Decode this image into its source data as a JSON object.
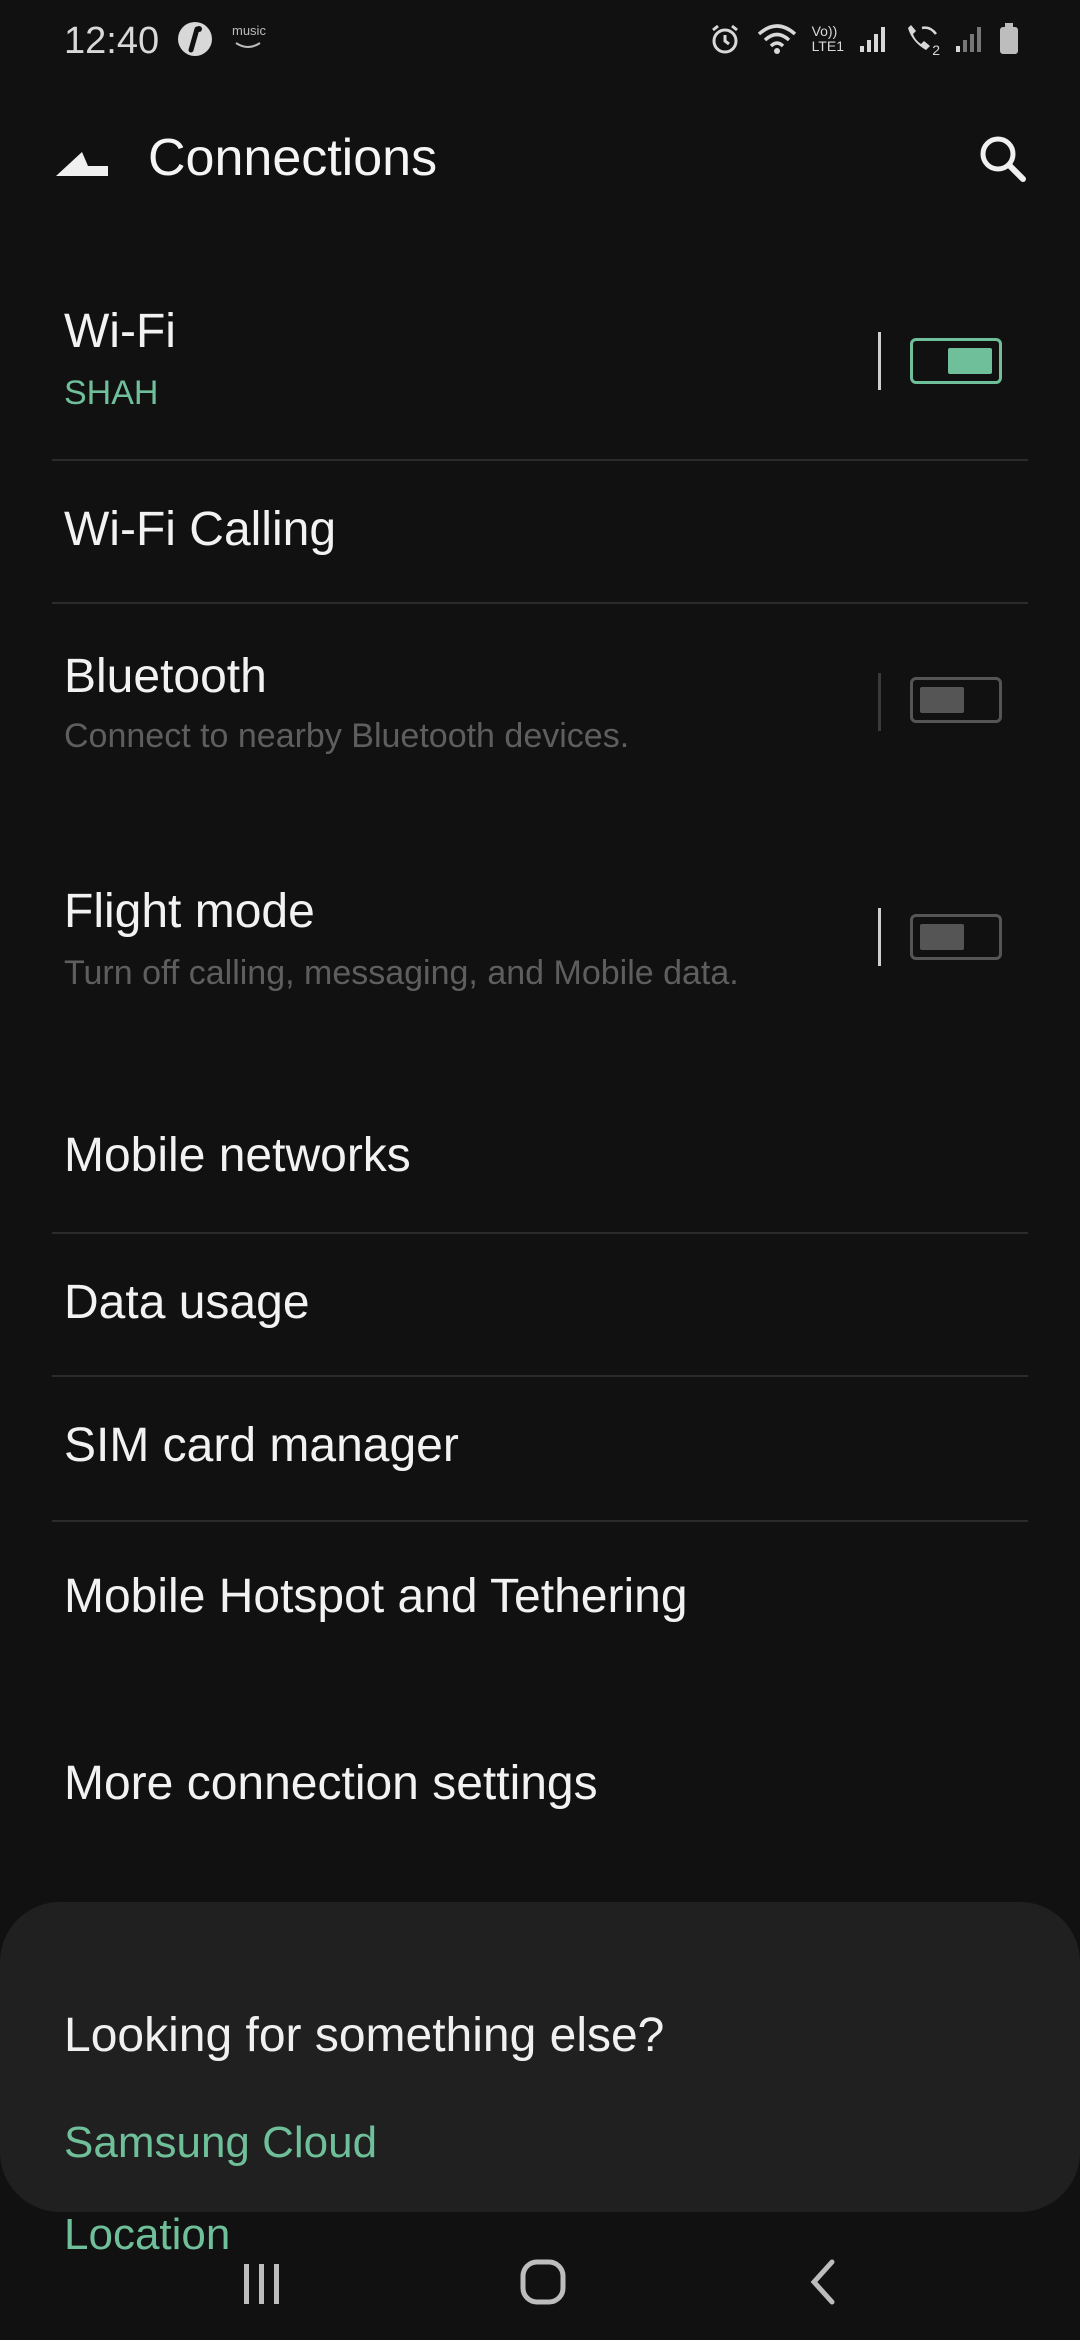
{
  "status_bar": {
    "time": "12:40",
    "icons_left": [
      "mobile-app-icon",
      "amazon-music-icon"
    ],
    "music_label": "music",
    "icons_right": [
      "alarm-icon",
      "wifi-icon",
      "volte-icon",
      "signal-icon",
      "wifi-calling-icon",
      "signal-icon-2",
      "battery-icon"
    ],
    "volte_label": "Vo))",
    "lte_label": "LTE1",
    "sim2_label": "2"
  },
  "header": {
    "title": "Connections"
  },
  "settings": [
    {
      "id": "wifi",
      "title": "Wi-Fi",
      "subtitle": "SHAH",
      "toggle": true,
      "state": "on"
    },
    {
      "id": "wifi-calling",
      "title": "Wi-Fi Calling"
    },
    {
      "id": "bluetooth",
      "title": "Bluetooth",
      "subtitle": "Connect to nearby Bluetooth devices.",
      "toggle": true,
      "state": "off"
    },
    {
      "id": "flight-mode",
      "title": "Flight mode",
      "subtitle": "Turn off calling, messaging, and Mobile data.",
      "toggle": true,
      "state": "off"
    },
    {
      "id": "mobile-networks",
      "title": "Mobile networks"
    },
    {
      "id": "data-usage",
      "title": "Data usage"
    },
    {
      "id": "sim-card-manager",
      "title": "SIM card manager"
    },
    {
      "id": "mobile-hotspot",
      "title": "Mobile Hotspot and Tethering"
    },
    {
      "id": "more-connection-settings",
      "title": "More connection settings"
    }
  ],
  "suggestions": {
    "title": "Looking for something else?",
    "links": [
      "Samsung Cloud",
      "Location"
    ]
  },
  "colors": {
    "accent": "#6fbf9a",
    "background": "#111111",
    "card": "#202020"
  },
  "nav_bar": {
    "icons": [
      "recent-apps-icon",
      "home-icon",
      "back-icon"
    ]
  }
}
